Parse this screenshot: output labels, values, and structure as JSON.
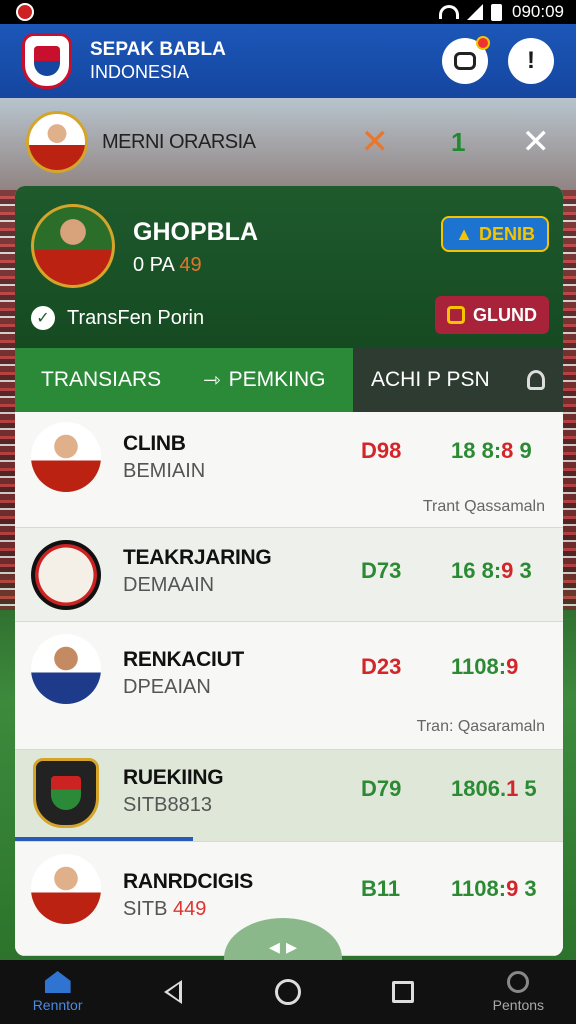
{
  "status_bar": {
    "time": "090:09"
  },
  "header": {
    "title_line1": "SEPAK BABLA",
    "title_line2": "INDONESIA",
    "alert_glyph": "!"
  },
  "match": {
    "name": "MERNI ORARSIA",
    "x_mark": "✕",
    "score": "1",
    "close": "✕"
  },
  "featured": {
    "name": "GHOPBLA",
    "sub_prefix": "0 PA",
    "sub_number": "49",
    "transfer_label": "TransFen Porin",
    "detail_button": "DENIB",
    "glund_button": "GLUND"
  },
  "tabs": [
    {
      "label": "TRANSIARS"
    },
    {
      "label": "PEMKING"
    },
    {
      "label": "ACHI P PSN"
    }
  ],
  "players": [
    {
      "name": "CLINB",
      "club": "BEMIAIN",
      "club_tail": "",
      "value": "D98",
      "value_color": "red",
      "score_a": "18 8:",
      "score_b": "8",
      "score_c": " 9",
      "team": "Trant Qassamaln"
    },
    {
      "name": "TEAKRJARING",
      "club": "DEMAAIN",
      "club_tail": "",
      "value": "D73",
      "value_color": "green",
      "score_a": "16 8:",
      "score_b": "9",
      "score_c": " 3",
      "team": ""
    },
    {
      "name": "RENKACIUT",
      "club": "DPEAIAN",
      "club_tail": "",
      "value": "D23",
      "value_color": "red",
      "score_a": "1108:",
      "score_b": "9",
      "score_c": "",
      "team": "Tran: Qasaramaln"
    },
    {
      "name": "RUEKIING",
      "club": "SITB8813",
      "club_tail": "",
      "value": "D79",
      "value_color": "green",
      "score_a": "1806.",
      "score_b": "1",
      "score_c": " 5",
      "team": ""
    },
    {
      "name": "RANRDCIGIS",
      "club": "SITB ",
      "club_tail": "449",
      "value": "B11",
      "value_color": "green",
      "score_a": "1108:",
      "score_b": "9",
      "score_c": " 3",
      "team": ""
    }
  ],
  "nav": {
    "home_label": "Renntor",
    "people_label": "Pentons"
  },
  "colors": {
    "header_blue": "#1c57b8",
    "card_green": "#1e5a2c",
    "value_red": "#d2262b",
    "value_green": "#2c8a34",
    "accent_orange": "#e0762c"
  },
  "icons": [
    "app-logo",
    "chat-icon",
    "alert-icon",
    "check-icon",
    "detail-icon",
    "glund-icon",
    "arrow-icon",
    "user-icon",
    "home-icon",
    "back-icon",
    "home-circle-icon",
    "recents-icon",
    "people-icon"
  ]
}
